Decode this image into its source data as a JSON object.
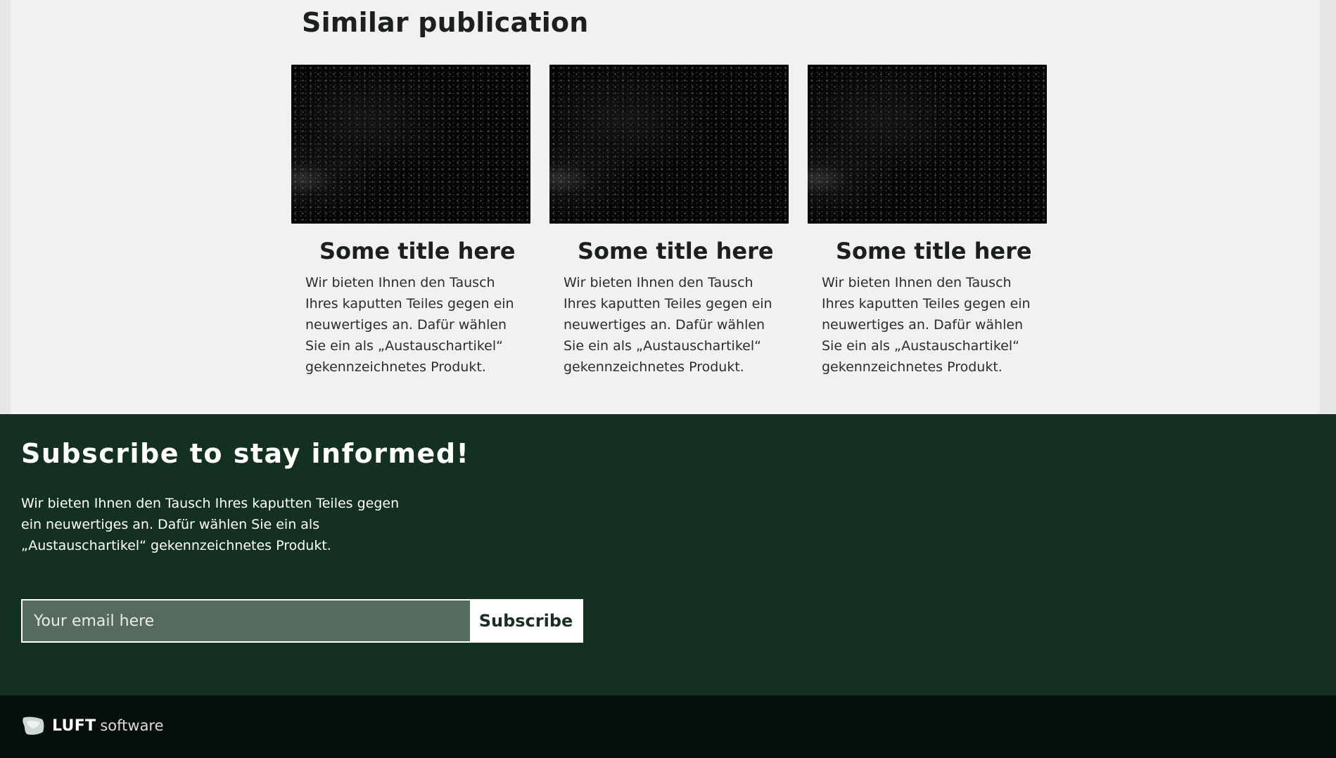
{
  "similar": {
    "heading": "Similar publication",
    "cards": [
      {
        "title": "Some title here",
        "text": "Wir bieten Ihnen den Tausch Ihres kaputten Teiles gegen ein neuwertiges an. Dafür wählen Sie ein als „Austauschartikel“ gekennzeichnetes Produkt."
      },
      {
        "title": "Some title here",
        "text": "Wir bieten Ihnen den Tausch Ihres kaputten Teiles gegen ein neuwertiges an. Dafür wählen Sie ein als „Austauschartikel“ gekennzeichnetes Produkt."
      },
      {
        "title": "Some title here",
        "text": "Wir bieten Ihnen den Tausch Ihres kaputten Teiles gegen ein neuwertiges an. Dafür wählen Sie ein als „Austauschartikel“ gekennzeichnetes Produkt."
      }
    ]
  },
  "subscribe": {
    "title": "Subscribe to stay informed!",
    "text": "Wir bieten Ihnen den Tausch Ihres kaputten Teiles gegen ein neuwertiges an. Dafür wählen Sie ein als „Austauschartikel“ gekennzeichnetes Produkt.",
    "email_placeholder": "Your email here",
    "button_label": "Subscribe"
  },
  "footer": {
    "brand_name": "LUFT",
    "brand_suffix": "software",
    "logo_icon": "cloud-logo-icon"
  },
  "colors": {
    "subscribe_bg": "#143020",
    "footer_bg": "#07100b",
    "input_bg": "#566a5e"
  }
}
